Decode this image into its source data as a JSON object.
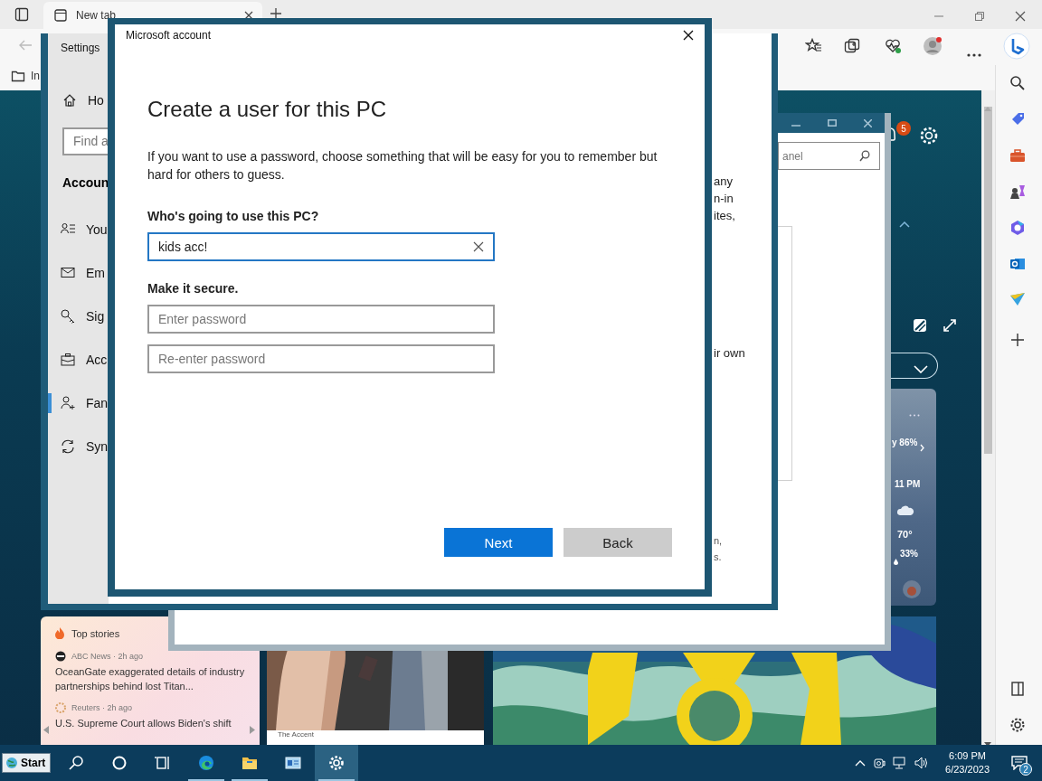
{
  "browser": {
    "tabs": [
      {
        "label": "New tab",
        "selected": true
      }
    ],
    "favorites": [
      {
        "label": "In"
      }
    ],
    "notification_badge": "5",
    "weather": {
      "summary": "y 86%",
      "hour": "11 PM",
      "temperature": "70°",
      "precipitation": "33%"
    },
    "news": {
      "heading": "Top stories",
      "items": [
        {
          "source": "ABC News · 2h ago",
          "headline": "OceanGate exaggerated details of industry partnerships behind lost Titan..."
        },
        {
          "source": "Reuters · 2h ago",
          "headline": "U.S. Supreme Court allows Biden's shift"
        }
      ],
      "feature_caption": "The Accent"
    }
  },
  "control_panel": {
    "search_placeholder": "anel"
  },
  "settings": {
    "title": "Settings",
    "home": "Ho",
    "search_placeholder": "Find a",
    "section": "Accoun",
    "items": [
      {
        "label": "You",
        "selected": false
      },
      {
        "label": "Em",
        "selected": false
      },
      {
        "label": "Sig",
        "selected": false
      },
      {
        "label": "Acc",
        "selected": false
      },
      {
        "label": "Fan",
        "selected": true
      },
      {
        "label": "Syn",
        "selected": false
      }
    ],
    "content_fragments": [
      {
        "lines": [
          "any",
          "n-in",
          "ites,"
        ]
      },
      {
        "lines": [
          "ir own"
        ]
      },
      {
        "lines": [
          "n,",
          "s."
        ]
      }
    ]
  },
  "dialog": {
    "title": "Microsoft account",
    "heading": "Create a user for this PC",
    "intro": "If you want to use a password, choose something that will be easy for you to remember but hard for others to guess.",
    "name_label": "Who's going to use this PC?",
    "name_value": "kids acc!",
    "secure_label": "Make it secure.",
    "password_placeholder": "Enter password",
    "reenter_placeholder": "Re-enter password",
    "buttons": [
      {
        "label": "Next",
        "kind": "primary"
      },
      {
        "label": "Back",
        "kind": "secondary"
      }
    ]
  },
  "taskbar": {
    "start": "Start",
    "apps": [
      {
        "running": false,
        "selected": false
      },
      {
        "running": false,
        "selected": false
      },
      {
        "running": false,
        "selected": false
      },
      {
        "running": true,
        "selected": false
      },
      {
        "running": true,
        "selected": false
      },
      {
        "running": false,
        "selected": false
      },
      {
        "running": true,
        "selected": true
      }
    ],
    "time": "6:09 PM",
    "date": "6/23/2023",
    "notification_count": "2"
  }
}
